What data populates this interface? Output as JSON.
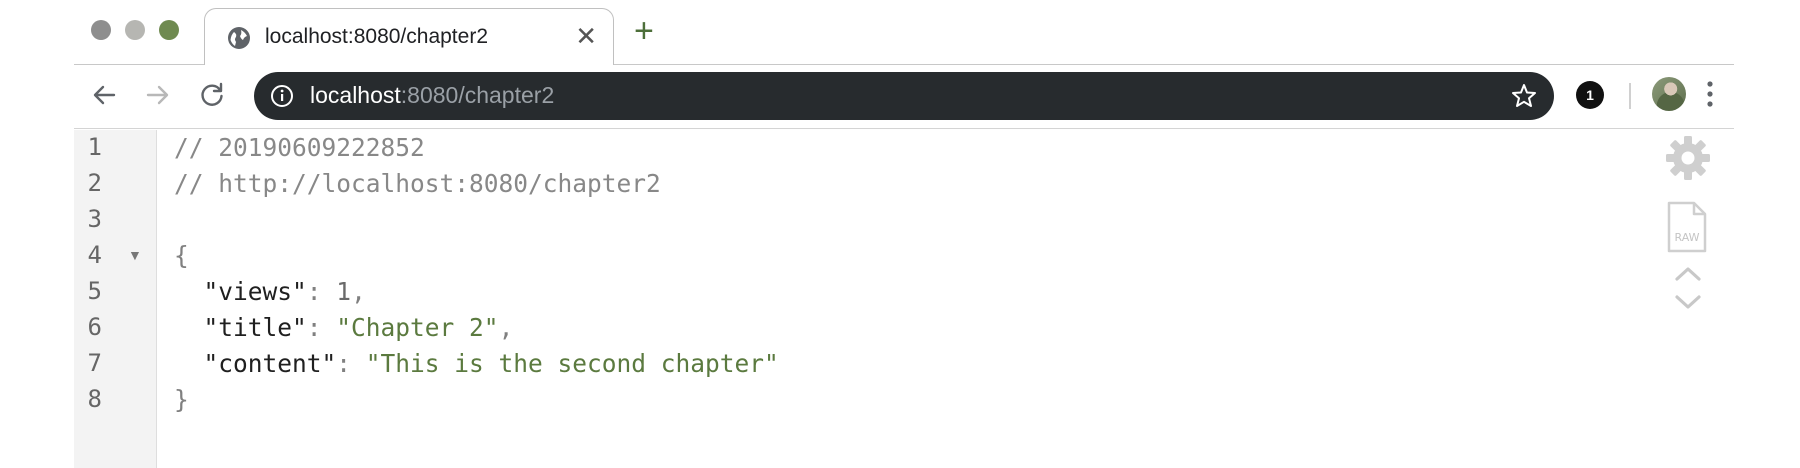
{
  "browser": {
    "tab": {
      "title": "localhost:8080/chapter2",
      "favicon": "globe-icon",
      "close_glyph": "✕"
    },
    "new_tab_glyph": "+",
    "toolbar": {
      "url_host": "localhost",
      "url_path": ":8080/chapter2",
      "extension_badge": "1"
    }
  },
  "viewer": {
    "lines": [
      {
        "number": "1"
      },
      {
        "number": "2"
      },
      {
        "number": "3"
      },
      {
        "number": "4"
      },
      {
        "number": "5"
      },
      {
        "number": "6"
      },
      {
        "number": "7"
      },
      {
        "number": "8"
      }
    ],
    "fold_glyph": "▼",
    "code": {
      "comment1": "// 20190609222852",
      "comment2": "// http://localhost:8080/chapter2",
      "open_brace": "{",
      "close_brace": "}",
      "entries": [
        {
          "key": "\"views\"",
          "sep": ": ",
          "value": "1",
          "trail": ","
        },
        {
          "key": "\"title\"",
          "sep": ": ",
          "value": "\"Chapter 2\"",
          "trail": ","
        },
        {
          "key": "\"content\"",
          "sep": ": ",
          "value": "\"This is the second chapter\"",
          "trail": ""
        }
      ]
    },
    "tools": {
      "raw_label": "RAW"
    }
  },
  "colors": {
    "omnibox_bg": "#272b2e",
    "string_green": "#5b7a3f",
    "accent_green": "#4d6f3a"
  }
}
